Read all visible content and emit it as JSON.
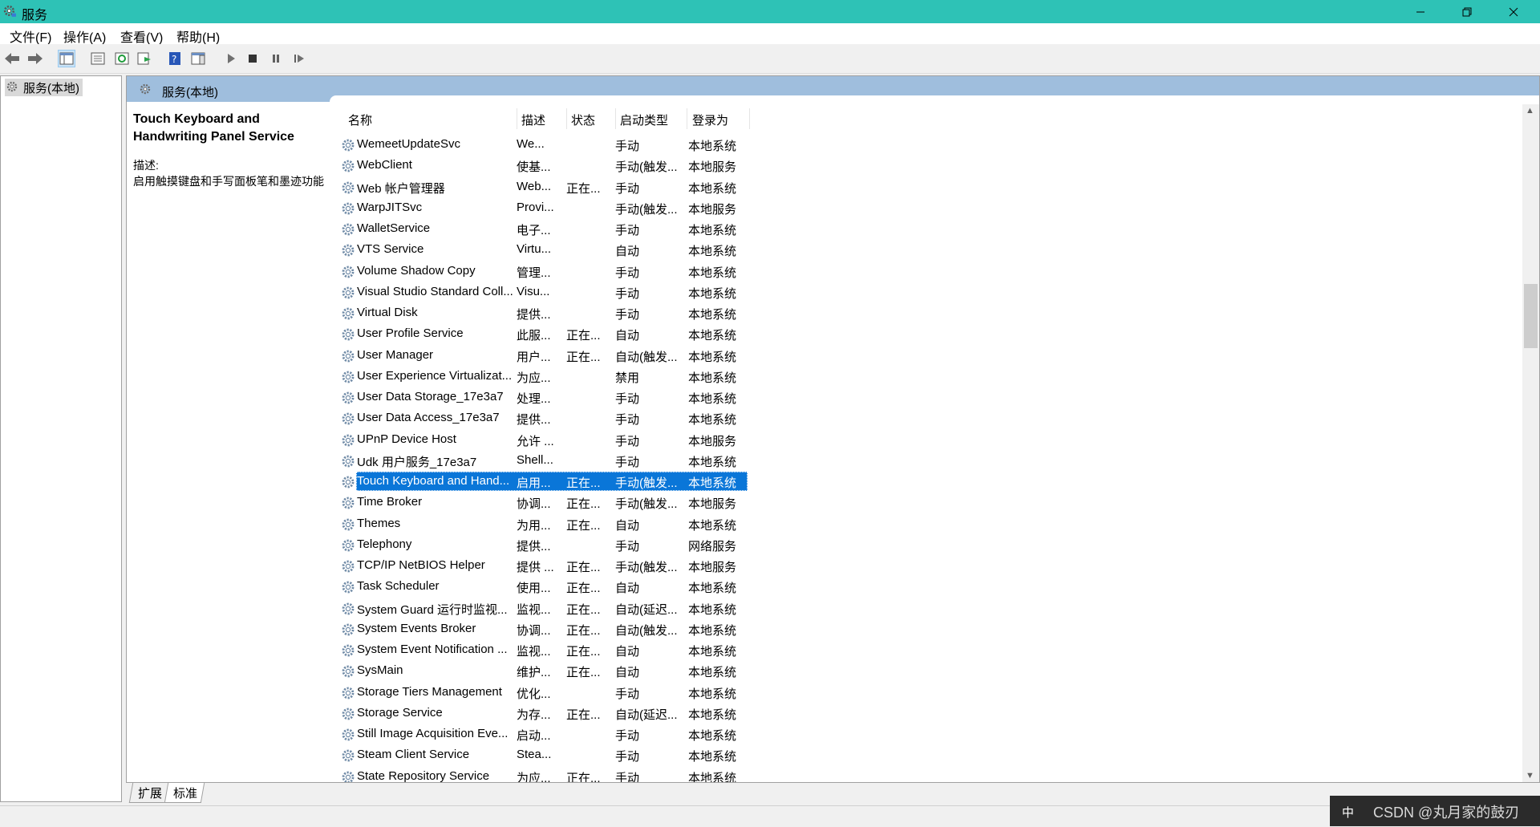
{
  "window": {
    "title": "服务"
  },
  "menu": [
    "文件(F)",
    "操作(A)",
    "查看(V)",
    "帮助(H)"
  ],
  "tree": {
    "root_label": "服务(本地)"
  },
  "pane": {
    "header_title": "服务(本地)",
    "selected_service_title": "Touch Keyboard and Handwriting Panel Service",
    "description_label": "描述:",
    "description_text": "启用触摸键盘和手写面板笔和墨迹功能"
  },
  "columns": {
    "name": "名称",
    "description": "描述",
    "status": "状态",
    "startup": "启动类型",
    "logon": "登录为"
  },
  "services": [
    {
      "name": "WemeetUpdateSvc",
      "desc": "We...",
      "status": "",
      "startup": "手动",
      "logon": "本地系统"
    },
    {
      "name": "WebClient",
      "desc": "使基...",
      "status": "",
      "startup": "手动(触发...",
      "logon": "本地服务"
    },
    {
      "name": "Web 帐户管理器",
      "desc": "Web...",
      "status": "正在...",
      "startup": "手动",
      "logon": "本地系统"
    },
    {
      "name": "WarpJITSvc",
      "desc": "Provi...",
      "status": "",
      "startup": "手动(触发...",
      "logon": "本地服务"
    },
    {
      "name": "WalletService",
      "desc": "电子...",
      "status": "",
      "startup": "手动",
      "logon": "本地系统"
    },
    {
      "name": "VTS Service",
      "desc": "Virtu...",
      "status": "",
      "startup": "自动",
      "logon": "本地系统"
    },
    {
      "name": "Volume Shadow Copy",
      "desc": "管理...",
      "status": "",
      "startup": "手动",
      "logon": "本地系统"
    },
    {
      "name": "Visual Studio Standard Coll...",
      "desc": "Visu...",
      "status": "",
      "startup": "手动",
      "logon": "本地系统"
    },
    {
      "name": "Virtual Disk",
      "desc": "提供...",
      "status": "",
      "startup": "手动",
      "logon": "本地系统"
    },
    {
      "name": "User Profile Service",
      "desc": "此服...",
      "status": "正在...",
      "startup": "自动",
      "logon": "本地系统"
    },
    {
      "name": "User Manager",
      "desc": "用户...",
      "status": "正在...",
      "startup": "自动(触发...",
      "logon": "本地系统"
    },
    {
      "name": "User Experience Virtualizat...",
      "desc": "为应...",
      "status": "",
      "startup": "禁用",
      "logon": "本地系统"
    },
    {
      "name": "User Data Storage_17e3a7",
      "desc": "处理...",
      "status": "",
      "startup": "手动",
      "logon": "本地系统"
    },
    {
      "name": "User Data Access_17e3a7",
      "desc": "提供...",
      "status": "",
      "startup": "手动",
      "logon": "本地系统"
    },
    {
      "name": "UPnP Device Host",
      "desc": "允许 ...",
      "status": "",
      "startup": "手动",
      "logon": "本地服务"
    },
    {
      "name": "Udk 用户服务_17e3a7",
      "desc": "Shell...",
      "status": "",
      "startup": "手动",
      "logon": "本地系统"
    },
    {
      "name": "Touch Keyboard and Hand...",
      "desc": "启用...",
      "status": "正在...",
      "startup": "手动(触发...",
      "logon": "本地系统",
      "selected": true
    },
    {
      "name": "Time Broker",
      "desc": "协调...",
      "status": "正在...",
      "startup": "手动(触发...",
      "logon": "本地服务"
    },
    {
      "name": "Themes",
      "desc": "为用...",
      "status": "正在...",
      "startup": "自动",
      "logon": "本地系统"
    },
    {
      "name": "Telephony",
      "desc": "提供...",
      "status": "",
      "startup": "手动",
      "logon": "网络服务"
    },
    {
      "name": "TCP/IP NetBIOS Helper",
      "desc": "提供 ...",
      "status": "正在...",
      "startup": "手动(触发...",
      "logon": "本地服务"
    },
    {
      "name": "Task Scheduler",
      "desc": "使用...",
      "status": "正在...",
      "startup": "自动",
      "logon": "本地系统"
    },
    {
      "name": "System Guard 运行时监视...",
      "desc": "监视...",
      "status": "正在...",
      "startup": "自动(延迟...",
      "logon": "本地系统"
    },
    {
      "name": "System Events Broker",
      "desc": "协调...",
      "status": "正在...",
      "startup": "自动(触发...",
      "logon": "本地系统"
    },
    {
      "name": "System Event Notification ...",
      "desc": "监视...",
      "status": "正在...",
      "startup": "自动",
      "logon": "本地系统"
    },
    {
      "name": "SysMain",
      "desc": "维护...",
      "status": "正在...",
      "startup": "自动",
      "logon": "本地系统"
    },
    {
      "name": "Storage Tiers Management",
      "desc": "优化...",
      "status": "",
      "startup": "手动",
      "logon": "本地系统"
    },
    {
      "name": "Storage Service",
      "desc": "为存...",
      "status": "正在...",
      "startup": "自动(延迟...",
      "logon": "本地系统"
    },
    {
      "name": "Still Image Acquisition Eve...",
      "desc": "启动...",
      "status": "",
      "startup": "手动",
      "logon": "本地系统"
    },
    {
      "name": "Steam Client Service",
      "desc": "Stea...",
      "status": "",
      "startup": "手动",
      "logon": "本地系统"
    },
    {
      "name": "State Repository Service",
      "desc": "为应...",
      "status": "正在...",
      "startup": "手动",
      "logon": "本地系统"
    }
  ],
  "bottom_tabs": [
    "扩展",
    "标准"
  ],
  "tray": {
    "ime": "中",
    "watermark": "CSDN @丸月家的鼓刃"
  }
}
